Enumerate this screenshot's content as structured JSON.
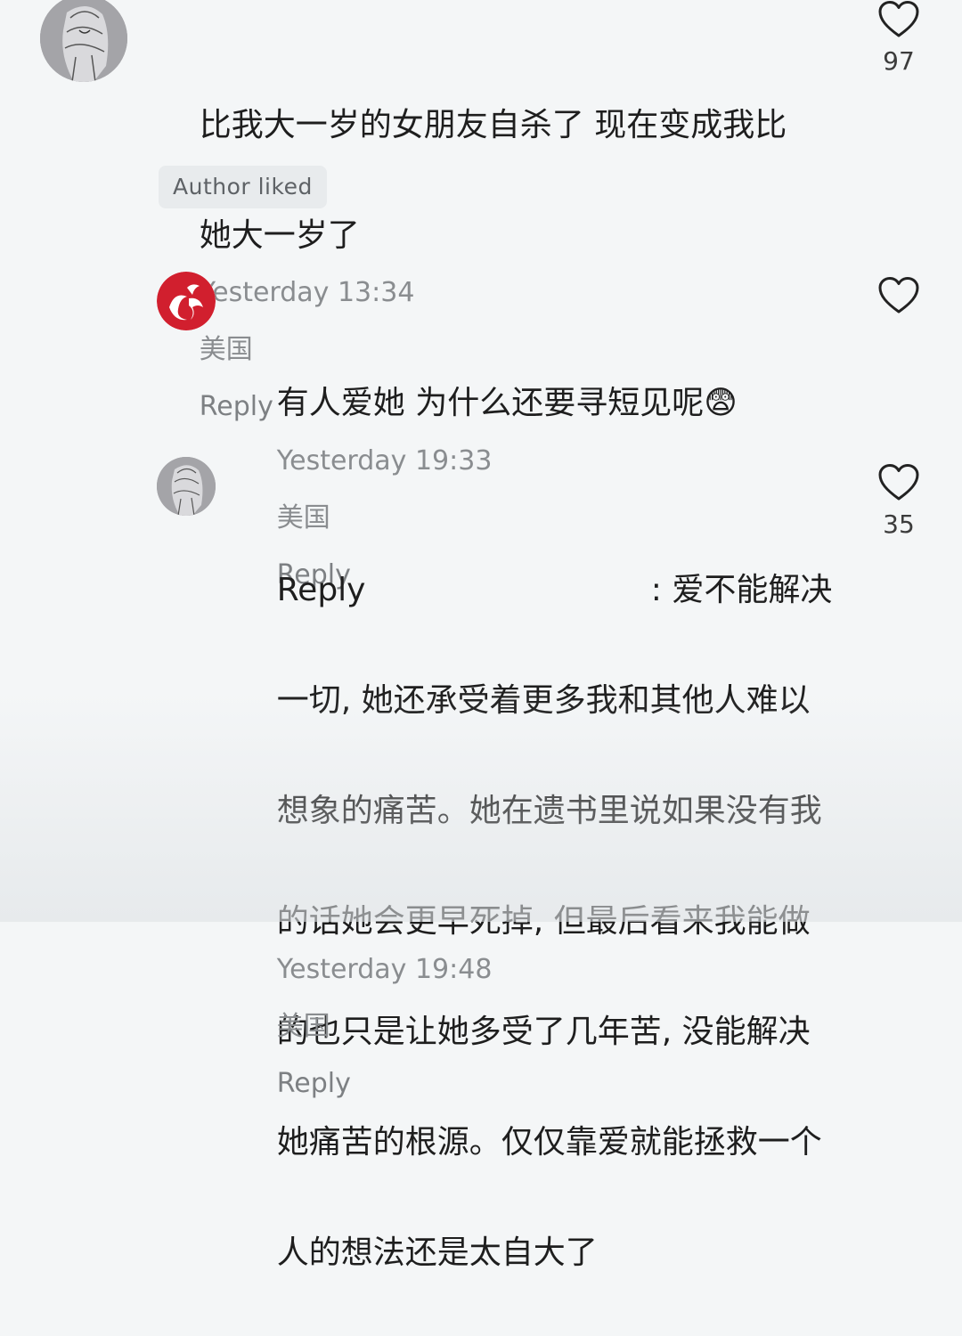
{
  "comments": [
    {
      "text_line1": "比我大一岁的女朋友自杀了 现在变成我比",
      "text_line2": "她大一岁了",
      "timestamp": "Yesterday 13:34",
      "location": "美国",
      "reply_label": "Reply",
      "likes": "97",
      "badge": "Author liked"
    },
    {
      "text": "有人爱她 为什么还要寻短见呢",
      "emoji": "😨",
      "timestamp": "Yesterday 19:33",
      "location": "美国",
      "reply_label": "Reply"
    },
    {
      "reply_prefix": "Reply",
      "text_first": ": 爱不能解决",
      "lines": [
        "一切, 她还承受着更多我和其他人难以",
        "想象的痛苦。她在遗书里说如果没有我",
        "的话她会更早死掉, 但最后看来我能做",
        "的也只是让她多受了几年苦, 没能解决",
        "她痛苦的根源。仅仅靠爱就能拯救一个",
        "人的想法还是太自大了"
      ],
      "timestamp": "Yesterday 19:48",
      "location": "美国",
      "reply_label": "Reply",
      "likes": "35"
    }
  ],
  "icons": {
    "like": "heart-outline-icon",
    "avatar_1": "sketch-portrait-avatar",
    "avatar_2": "red-brand-logo-avatar",
    "avatar_3": "sketch-portrait-avatar"
  },
  "colors": {
    "background": "#f4f6f7",
    "text": "#1e1e1e",
    "meta": "#8a8d90",
    "badge_bg": "#e8ebed",
    "logo_red": "#d11f2e"
  }
}
